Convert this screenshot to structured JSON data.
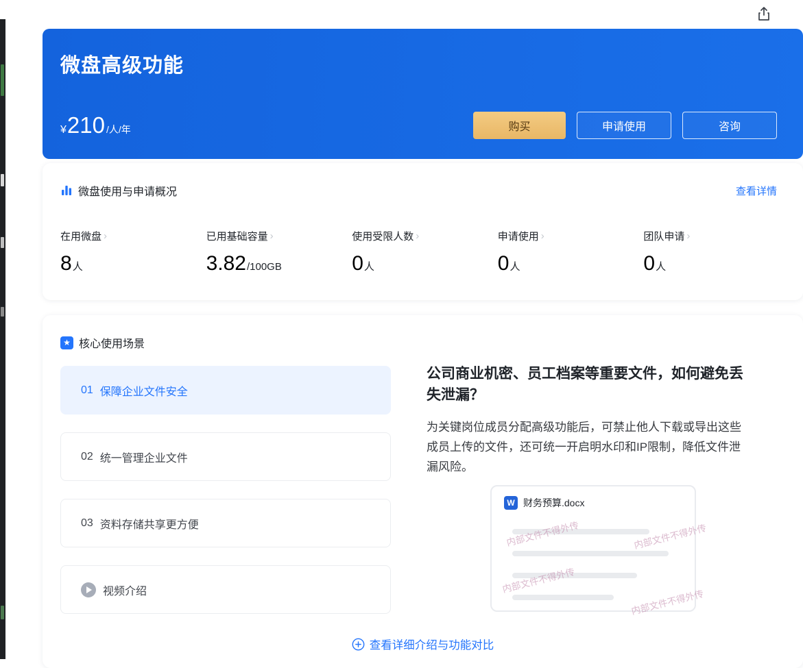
{
  "colors": {
    "accent_blue": "#2475fc",
    "banner_blue": "#1768e3",
    "buy_gold": "#eec276",
    "selected_item_bg": "#ecf3ff",
    "watermark_pink": "#bd82a6"
  },
  "banner": {
    "title": "微盘高级功能",
    "price_currency": "¥",
    "price_value": "210",
    "price_unit": "/人/年",
    "buy_label": "购买",
    "apply_label": "申请使用",
    "consult_label": "咨询"
  },
  "overview": {
    "title": "微盘使用与申请概况",
    "detail_link": "查看详情",
    "stats": [
      {
        "label": "在用微盘",
        "value": "8",
        "unit": "人"
      },
      {
        "label": "已用基础容量",
        "value": "3.82",
        "unit": "/100GB"
      },
      {
        "label": "使用受限人数",
        "value": "0",
        "unit": "人"
      },
      {
        "label": "申请使用",
        "value": "0",
        "unit": "人"
      },
      {
        "label": "团队申请",
        "value": "0",
        "unit": "人"
      }
    ]
  },
  "scenarios": {
    "title": "核心使用场景",
    "badge_star": "★",
    "items": [
      {
        "index": "01",
        "label": "保障企业文件安全"
      },
      {
        "index": "02",
        "label": "统一管理企业文件"
      },
      {
        "index": "03",
        "label": "资料存储共享更方便"
      }
    ],
    "video_label": "视频介绍",
    "detail": {
      "heading": "公司商业机密、员工档案等重要文件，如何避免丢失泄漏？",
      "body": "为关键岗位成员分配高级功能后，可禁止他人下载或导出这些成员上传的文件，还可统一开启明水印和IP限制，降低文件泄漏风险。",
      "doc_name": "财务预算.docx",
      "word_icon": "W",
      "watermark": "内部文件不得外传"
    },
    "compare_link": "查看详细介绍与功能对比"
  }
}
